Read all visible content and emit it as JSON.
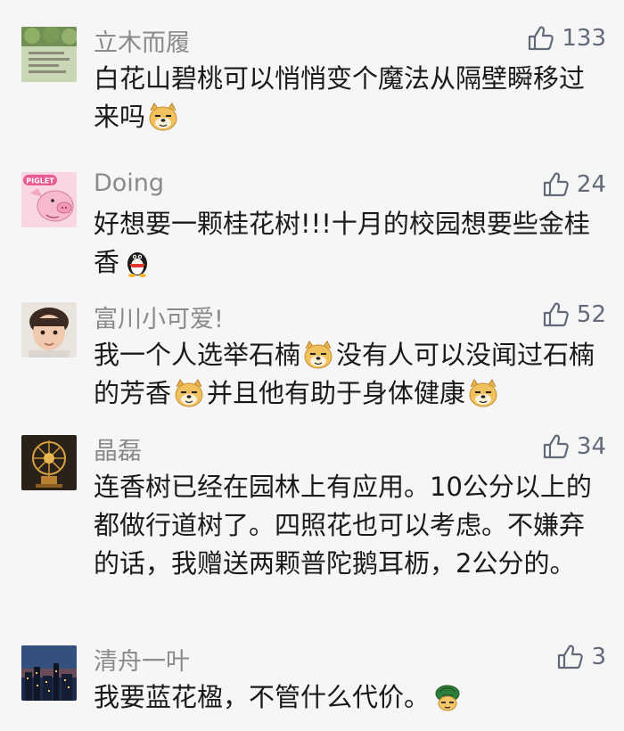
{
  "comments": [
    {
      "name": "立木而履",
      "likes": "133",
      "avatar": "scenery-avatar",
      "text_parts": [
        "白花山碧桃可以悄悄变个魔法从隔壁瞬移过来吗"
      ],
      "emoji": [
        "doge-emoji"
      ]
    },
    {
      "name": "Doing",
      "likes": "24",
      "avatar": "piglet-avatar",
      "avatar_text": "PIGLET",
      "text_parts": [
        "好想要一颗桂花树!!!十月的校园想要些金桂香"
      ],
      "emoji": [
        "penguin-emoji"
      ]
    },
    {
      "name": "富川小可爱!",
      "likes": "52",
      "avatar": "baby-photo-avatar",
      "text_parts": [
        "我一个人选举石楠",
        "没有人可以没闻过石楠的芳香",
        "并且他有助于身体健康"
      ],
      "emoji": [
        "doge-emoji",
        "doge-emoji",
        "doge-emoji"
      ]
    },
    {
      "name": "晶磊",
      "likes": "34",
      "avatar": "golden-sculpture-avatar",
      "text_parts": [
        "连香树已经在园林上有应用。10公分以上的都做行道树了。四照花也可以考虑。不嫌弃的话，我赠送两颗普陀鹅耳枥，2公分的。"
      ],
      "emoji": []
    },
    {
      "name": "清舟一叶",
      "likes": "3",
      "avatar": "city-night-avatar",
      "text_parts": [
        "我要蓝花楹，不管什么代价。"
      ],
      "emoji": [
        "turtle-emoji"
      ]
    }
  ],
  "colors": {
    "background": "#f6f6f6",
    "name": "#8a8a8a",
    "like": "#626a7a",
    "text": "#1a1a1a"
  }
}
